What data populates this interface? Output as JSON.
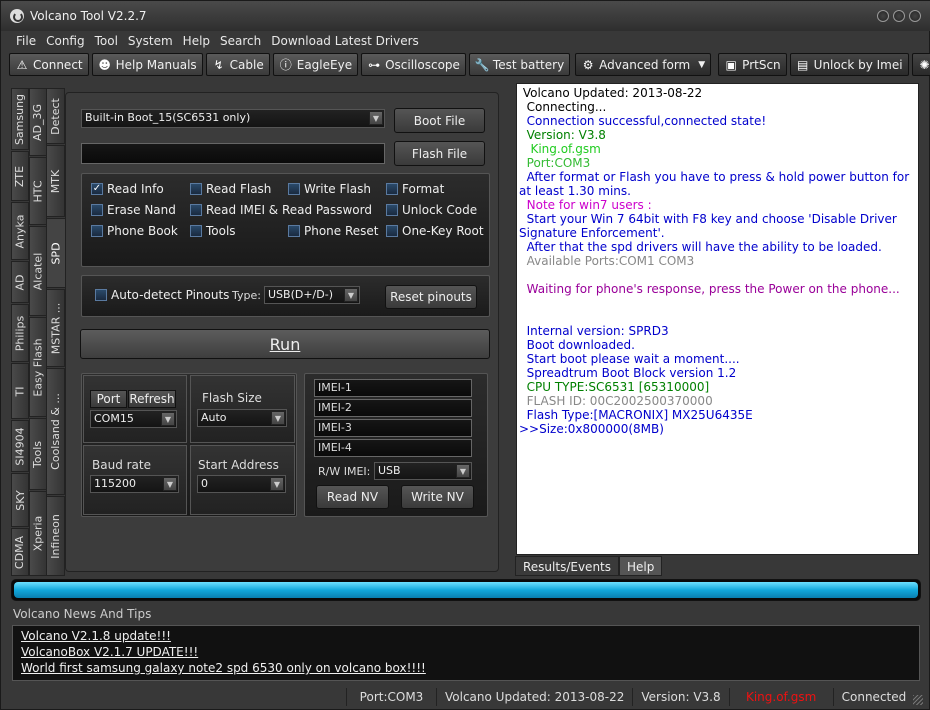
{
  "window": {
    "title": "Volcano Tool V2.2.7"
  },
  "menu": [
    "File",
    "Config",
    "Tool",
    "System",
    "Help",
    "Search",
    "Download Latest Drivers"
  ],
  "toolbar": [
    {
      "label": "Connect",
      "icon": "warning-icon"
    },
    {
      "label": "Help Manuals",
      "icon": "people-icon"
    },
    {
      "label": "Cable",
      "icon": "cable-icon"
    },
    {
      "label": "EagleEye",
      "icon": "info-icon"
    },
    {
      "label": "Oscilloscope",
      "icon": "plug-icon"
    },
    {
      "label": "Test battery",
      "icon": "wrench-icon"
    },
    {
      "label": "Advanced form",
      "icon": "gear-icon"
    },
    {
      "label": "PrtScn",
      "icon": "screenshot-icon"
    },
    {
      "label": "Unlock by Imei",
      "icon": "unlock-icon"
    }
  ],
  "left_tabs": {
    "col1": [
      "Samsung",
      "ZTE",
      "Anyka",
      "AD",
      "Philips",
      "TI",
      "SI4904",
      "SKY",
      "CDMA"
    ],
    "col2": [
      "AD_3G",
      "HTC",
      "Alcatel",
      "Easy Flash",
      "Tools",
      "Xperia"
    ],
    "col3": [
      "Detect",
      "MTK",
      "SPD",
      "MSTAR ...",
      "Coolsand & ...",
      "Infineon"
    ]
  },
  "boot": {
    "selected": "Built-in Boot_15(SC6531 only)",
    "boot_file_label": "Boot File",
    "flash_file_label": "Flash File",
    "flash_path": ""
  },
  "options": [
    {
      "label": "Read Info",
      "checked": true
    },
    {
      "label": "Read Flash",
      "checked": false
    },
    {
      "label": "Write Flash",
      "checked": false
    },
    {
      "label": "Format",
      "checked": false
    },
    {
      "label": "Erase Nand",
      "checked": false
    },
    {
      "label": "Read IMEI & Read Password",
      "checked": false
    },
    {
      "label": "Unlock Code",
      "checked": false
    },
    {
      "label": "Phone Book",
      "checked": false
    },
    {
      "label": "Tools",
      "checked": false
    },
    {
      "label": "Phone Reset",
      "checked": false
    },
    {
      "label": "One-Key Root",
      "checked": false
    }
  ],
  "pinouts": {
    "auto_detect_label": "Auto-detect Pinouts",
    "type_label": "Type:",
    "type_value": "USB(D+/D-)",
    "reset_label": "Reset pinouts"
  },
  "run_label": "Run",
  "port": {
    "port_label": "Port",
    "refresh_label": "Refresh",
    "port_value": "COM15",
    "flash_size_label": "Flash Size",
    "flash_size_value": "Auto",
    "baud_label": "Baud rate",
    "baud_value": "115200",
    "start_label": "Start Address",
    "start_value": "0"
  },
  "imei": {
    "fields": [
      "IMEI-1",
      "IMEI-2",
      "IMEI-3",
      "IMEI-4"
    ],
    "rw_label": "R/W IMEI:",
    "rw_value": "USB",
    "read_label": "Read NV",
    "write_label": "Write NV"
  },
  "log": [
    {
      "text": " Volcano Updated: 2013-08-22",
      "color": "#000000"
    },
    {
      "text": "  Connecting...",
      "color": "#000000"
    },
    {
      "text": "  Connection successful,connected state!",
      "color": "#0000cc"
    },
    {
      "text": "  Version: V3.8",
      "color": "#008000"
    },
    {
      "text": "   King.of.gsm",
      "color": "#22cc22"
    },
    {
      "text": "  Port:COM3",
      "color": "#33bb33"
    },
    {
      "text": "  After format or Flash you have to press & hold power button for at least 1.30 mins.",
      "color": "#0000cc"
    },
    {
      "text": "  Note for win7 users :",
      "color": "#cc00cc"
    },
    {
      "text": "  Start your Win 7 64bit with F8 key and choose 'Disable Driver Signature Enforcement'.",
      "color": "#0000cc"
    },
    {
      "text": "  After that the spd drivers will have the ability to be loaded.",
      "color": "#0000cc"
    },
    {
      "text": "  Available Ports:COM1 COM3",
      "color": "#888888"
    },
    {
      "text": " ",
      "color": "#000000"
    },
    {
      "text": "  Waiting for phone's response, press the Power on the phone...",
      "color": "#990099"
    },
    {
      "text": " ",
      "color": "#000000"
    },
    {
      "text": " ",
      "color": "#000000"
    },
    {
      "text": "  Internal version: SPRD3",
      "color": "#0000cc"
    },
    {
      "text": "  Boot downloaded.",
      "color": "#0000cc"
    },
    {
      "text": "  Start boot please wait a moment....",
      "color": "#0000cc"
    },
    {
      "text": "  Spreadtrum Boot Block version 1.2",
      "color": "#0000cc"
    },
    {
      "text": "  CPU TYPE:SC6531 [65310000]",
      "color": "#008000"
    },
    {
      "text": "  FLASH ID: 00C2002500370000",
      "color": "#888888"
    },
    {
      "text": "  Flash Type:[MACRONIX] MX25U6435E",
      "color": "#0000cc"
    },
    {
      "text": ">>Size:0x800000(8MB)",
      "color": "#0000cc"
    }
  ],
  "log_tabs": [
    "Results/Events",
    "Help"
  ],
  "progress": 1.0,
  "news": {
    "title": "Volcano News And Tips",
    "items": [
      "Volcano V2.1.8 update!!!",
      "VolcanoBox V2.1.7 UPDATE!!!",
      "World first samsung galaxy note2 spd 6530 only on volcano box!!!!"
    ]
  },
  "status": {
    "port": "Port:COM3",
    "updated": "Volcano Updated: 2013-08-22",
    "version": "Version: V3.8",
    "user": "King.of.gsm",
    "state": "Connected"
  }
}
